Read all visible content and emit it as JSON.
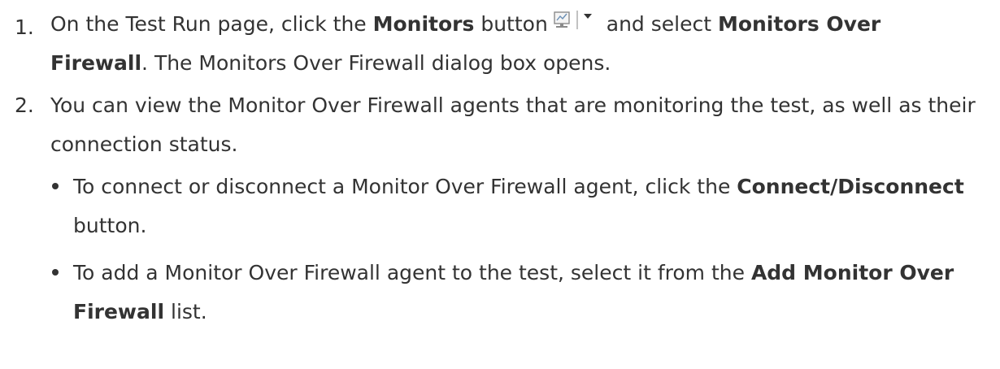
{
  "steps": [
    {
      "number": "1.",
      "parts": {
        "t1": "On the Test Run page, click the ",
        "b1": "Monitors",
        "t2": " button",
        "t3": " and select ",
        "b2": "Monitors Over Firewall",
        "t4": ". The Monitors Over Firewall dialog box opens."
      },
      "icon": "monitor-dropdown-icon"
    },
    {
      "number": "2.",
      "text": "You can view the Monitor Over Firewall agents that are monitoring the test, as well as their connection status.",
      "bullets": [
        {
          "t1": "To connect or disconnect a Monitor Over Firewall agent, click the ",
          "b1": "Connect/Disconnect",
          "t2": " button."
        },
        {
          "t1": "To add a Monitor Over Firewall agent to the test, select it from the ",
          "b1": "Add Monitor Over Firewall",
          "t2": " list."
        }
      ]
    }
  ]
}
